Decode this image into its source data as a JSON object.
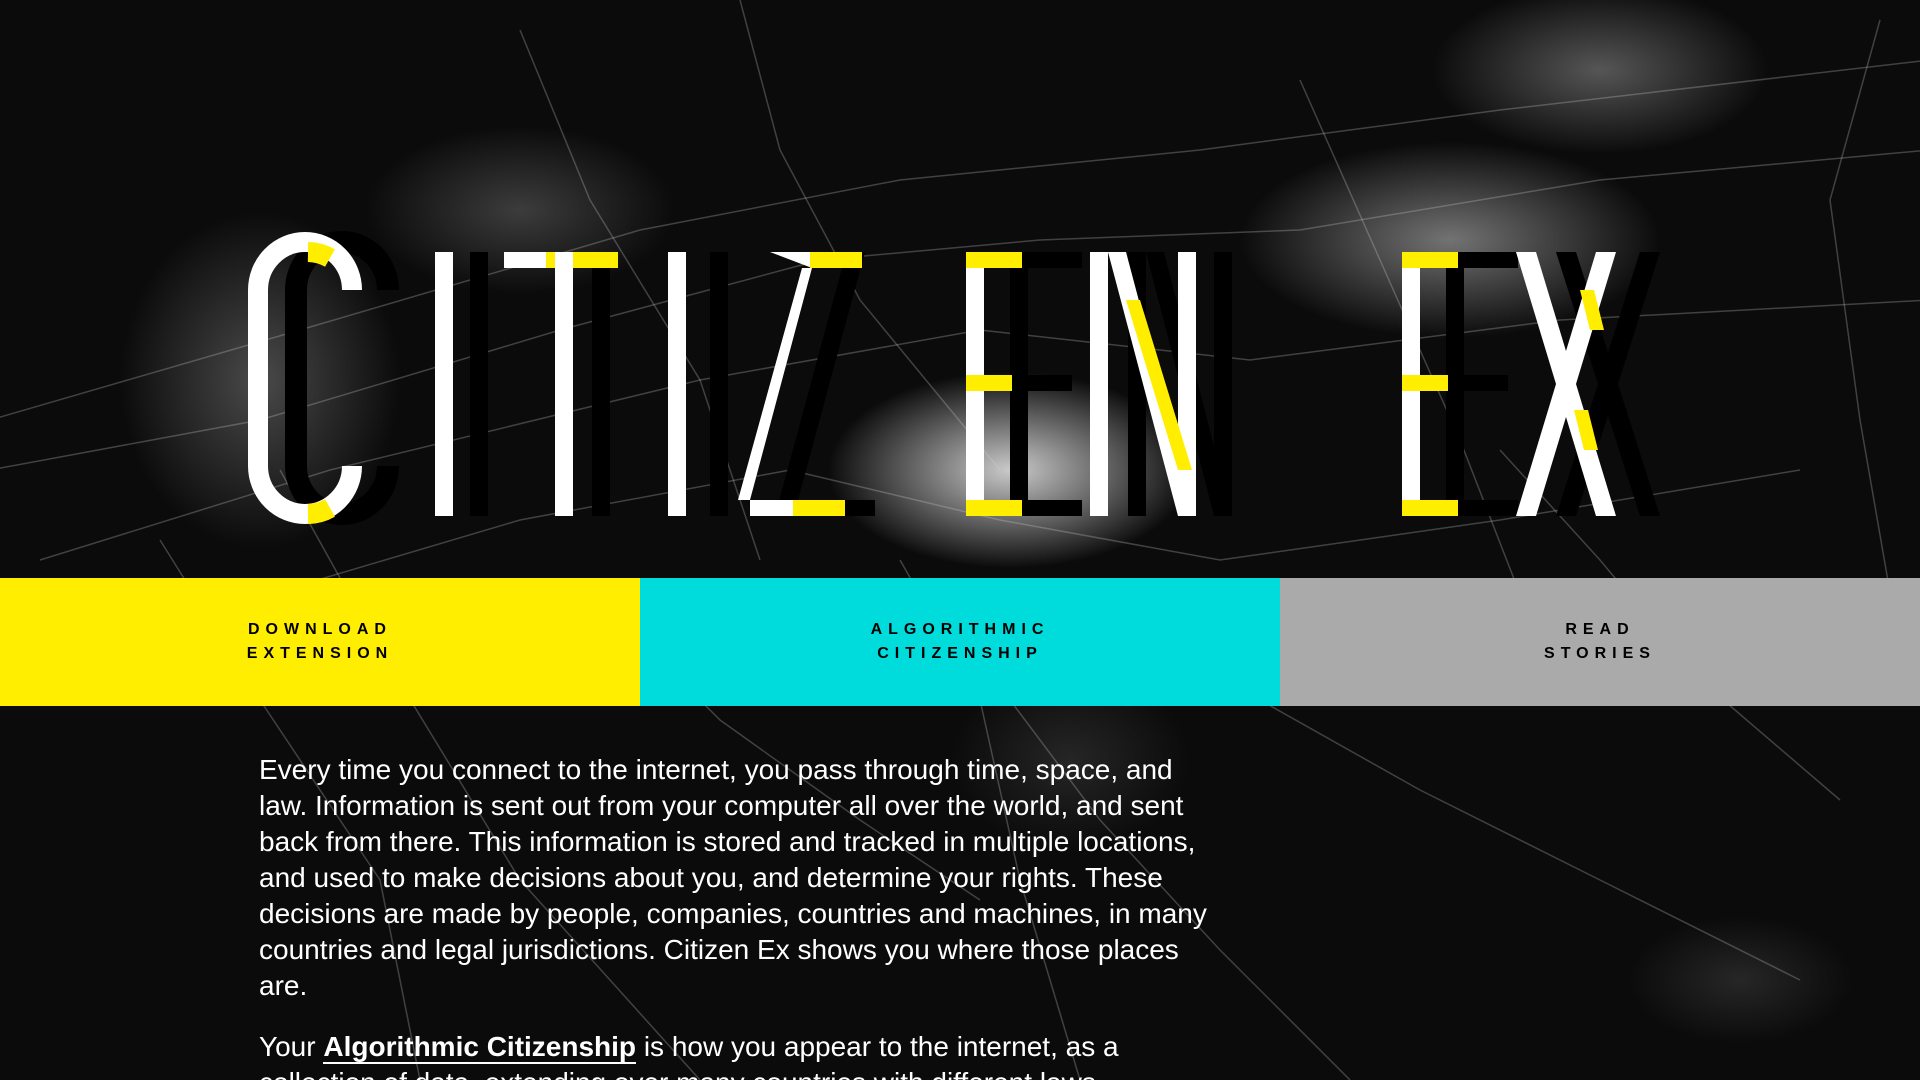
{
  "hero": {
    "title": "CITIZEN EX",
    "colors": {
      "front_letters": "#ffffff",
      "shadow_letters": "#000000",
      "highlight": "#ffee00"
    }
  },
  "nav": {
    "download": {
      "line1": "DOWNLOAD",
      "line2": "EXTENSION",
      "color": "#ffee00"
    },
    "algorithmic": {
      "line1": "ALGORITHMIC",
      "line2": "CITIZENSHIP",
      "color": "#00dbdb"
    },
    "read": {
      "line1": "READ",
      "line2": "STORIES",
      "color": "#aaaaaa"
    }
  },
  "intro": {
    "paragraph1": "Every time you connect to the internet, you pass through time, space, and law. Information is sent out from your computer all over the world, and sent back from there. This information is stored and tracked in multiple locations, and used to make decisions about you, and determine your rights. These decisions are made by people, companies, countries and machines, in many countries and legal jurisdictions. Citizen Ex shows you where those places are.",
    "paragraph2_prefix": "Your ",
    "paragraph2_link": "Algorithmic Citizenship",
    "paragraph2_suffix": " is how you appear to the internet, as a collection of data, extending over many countries with different laws."
  }
}
